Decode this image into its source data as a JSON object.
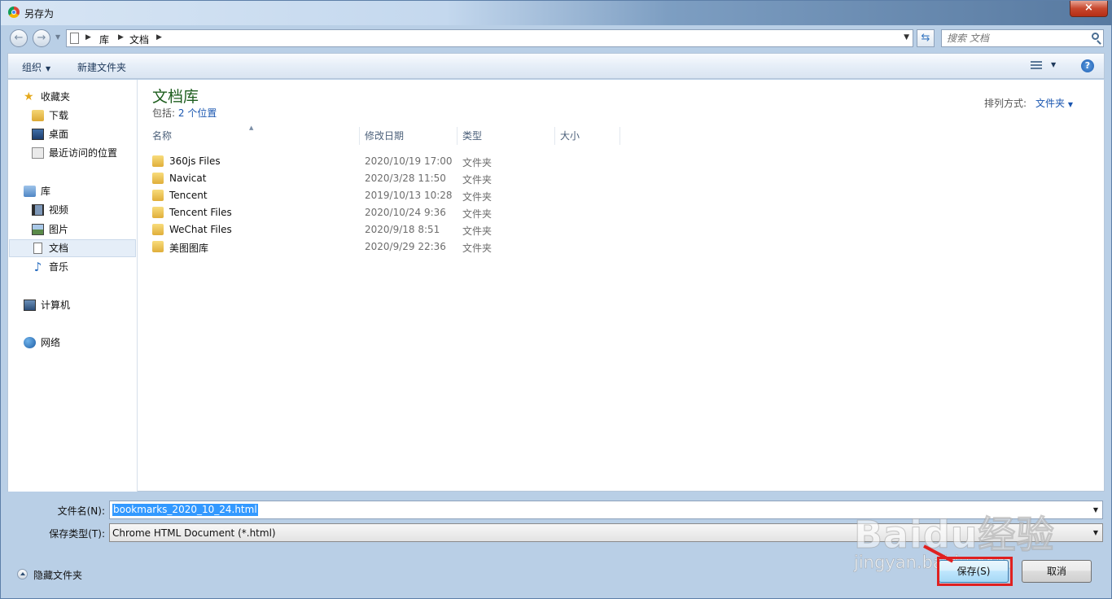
{
  "window": {
    "title": "另存为",
    "close_glyph": "×"
  },
  "address": {
    "breadcrumbs": [
      "库",
      "文档"
    ],
    "back_glyph": "←",
    "forward_glyph": "→",
    "search_placeholder": "搜索 文档"
  },
  "toolbar": {
    "organize": "组织",
    "new_folder": "新建文件夹",
    "help": "?"
  },
  "nav": {
    "favorites": {
      "label": "收藏夹",
      "items": [
        "下载",
        "桌面",
        "最近访问的位置"
      ]
    },
    "libraries": {
      "label": "库",
      "items": [
        "视频",
        "图片",
        "文档",
        "音乐"
      ],
      "selected": "文档"
    },
    "computer": "计算机",
    "network": "网络"
  },
  "library": {
    "title": "文档库",
    "includes_label": "包括:",
    "includes_link": "2 个位置",
    "sort_label": "排列方式:",
    "sort_value": "文件夹"
  },
  "columns": [
    "名称",
    "修改日期",
    "类型",
    "大小"
  ],
  "files": [
    {
      "name": "360js Files",
      "date": "2020/10/19 17:00",
      "type": "文件夹"
    },
    {
      "name": "Navicat",
      "date": "2020/3/28 11:50",
      "type": "文件夹"
    },
    {
      "name": "Tencent",
      "date": "2019/10/13 10:28",
      "type": "文件夹"
    },
    {
      "name": "Tencent Files",
      "date": "2020/10/24 9:36",
      "type": "文件夹"
    },
    {
      "name": "WeChat Files",
      "date": "2020/9/18 8:51",
      "type": "文件夹"
    },
    {
      "name": "美图图库",
      "date": "2020/9/29 22:36",
      "type": "文件夹"
    }
  ],
  "form": {
    "filename_label": "文件名(N):",
    "filename_value": "bookmarks_2020_10_24.html",
    "filetype_label": "保存类型(T):",
    "filetype_value": "Chrome HTML Document (*.html)"
  },
  "footer": {
    "hide_folders": "隐藏文件夹",
    "save": "保存(S)",
    "cancel": "取消"
  },
  "watermark": {
    "brand": "Baidu经验",
    "url": "jingyan.baidu.com"
  },
  "colors": {
    "accent_link": "#1a56b0",
    "library_title": "#1e5e1e",
    "annotation_red": "#e02020"
  }
}
